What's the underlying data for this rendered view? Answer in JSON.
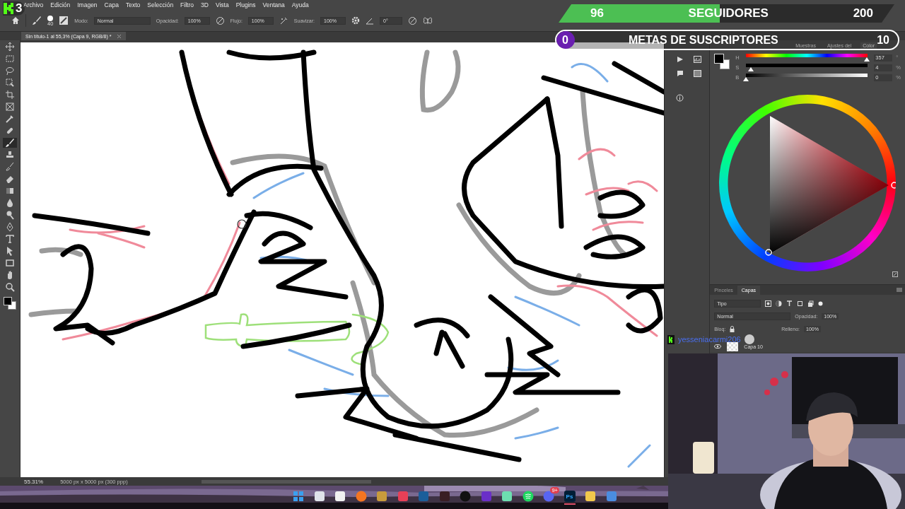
{
  "logo": {
    "number": "3"
  },
  "menu": [
    "Archivo",
    "Edición",
    "Imagen",
    "Capa",
    "Texto",
    "Selección",
    "Filtro",
    "3D",
    "Vista",
    "Plugins",
    "Ventana",
    "Ayuda"
  ],
  "options_bar": {
    "brush_size": "40",
    "mode_label": "Modo:",
    "mode": "Normal",
    "opacity_label": "Opacidad:",
    "opacity": "100%",
    "flow_label": "Flujo:",
    "flow": "100%",
    "smoothing_label": "Suavizar:",
    "smoothing": "100%",
    "angle": "0°"
  },
  "document_tab": {
    "title": "Sin título-1 al 55,3% (Capa 9, RGB/8) *"
  },
  "tools": [
    {
      "kind": "move",
      "selected": false
    },
    {
      "kind": "marquee",
      "selected": false
    },
    {
      "kind": "lasso",
      "selected": false
    },
    {
      "kind": "select",
      "selected": false
    },
    {
      "kind": "crop",
      "selected": false
    },
    {
      "kind": "frame",
      "selected": false
    },
    {
      "kind": "eyedropper",
      "selected": false
    },
    {
      "kind": "heal",
      "selected": false
    },
    {
      "kind": "brush",
      "selected": true
    },
    {
      "kind": "stamp",
      "selected": false
    },
    {
      "kind": "history",
      "selected": false
    },
    {
      "kind": "eraser",
      "selected": false
    },
    {
      "kind": "gradient",
      "selected": false
    },
    {
      "kind": "blur",
      "selected": false
    },
    {
      "kind": "dodge",
      "selected": false
    },
    {
      "kind": "pen",
      "selected": false
    },
    {
      "kind": "type",
      "selected": false
    },
    {
      "kind": "path",
      "selected": false
    },
    {
      "kind": "shape",
      "selected": false
    },
    {
      "kind": "hand",
      "selected": false
    },
    {
      "kind": "zoom",
      "selected": false
    }
  ],
  "followers_goal": {
    "current": "96",
    "label": "SEGUIDORES",
    "target": "200",
    "level": 0.48
  },
  "subscriber_goal": {
    "current": "0",
    "label": "METAS DE SUSCRIPTORES",
    "target": "10",
    "level": 0
  },
  "color_panel": {
    "tabs": [
      {
        "label": "Muestras",
        "selected": false
      },
      {
        "label": "Ajustes del",
        "selected": false
      },
      {
        "label": "Color",
        "selected": true
      }
    ],
    "sliders": [
      {
        "label": "H",
        "value": "357",
        "unit": "°",
        "level": 0.99
      },
      {
        "label": "S",
        "value": "4",
        "unit": "%",
        "level": 0.04
      },
      {
        "label": "B",
        "value": "0",
        "unit": "%",
        "level": 0
      }
    ]
  },
  "layers_panel": {
    "tabs": [
      {
        "label": "Pinceles",
        "selected": false
      },
      {
        "label": "Capas",
        "selected": true
      }
    ],
    "filter": "Tipo",
    "blend_mode": "Normal",
    "opacity_label": "Opacidad:",
    "opacity": "100%",
    "lock_label": "Bloq:",
    "fill_label": "Relleno:",
    "fill": "100%",
    "layers": [
      {
        "name": "Capa 10",
        "visible": true
      }
    ]
  },
  "chat_overlay": {
    "username": "yesseniacarmi206"
  },
  "status_bar": {
    "zoom": "55.31%",
    "size": "5000 px x 5000 px (300 ppp)"
  },
  "taskbar": [
    {
      "kind": "windows",
      "active": false
    },
    {
      "kind": "notes",
      "active": false
    },
    {
      "kind": "store",
      "active": false
    },
    {
      "kind": "orange",
      "active": false
    },
    {
      "kind": "gold",
      "active": false
    },
    {
      "kind": "red",
      "active": false
    },
    {
      "kind": "steam",
      "active": false
    },
    {
      "kind": "dark",
      "active": false
    },
    {
      "kind": "tiktok",
      "active": false
    },
    {
      "kind": "purple",
      "active": false
    },
    {
      "kind": "mint",
      "active": false
    },
    {
      "kind": "spotify",
      "active": false
    },
    {
      "kind": "discord",
      "badge": "9+",
      "active": false
    },
    {
      "kind": "photoshop",
      "label": "Ps",
      "active": true
    },
    {
      "kind": "folder",
      "active": false
    },
    {
      "kind": "photos",
      "active": false
    }
  ]
}
